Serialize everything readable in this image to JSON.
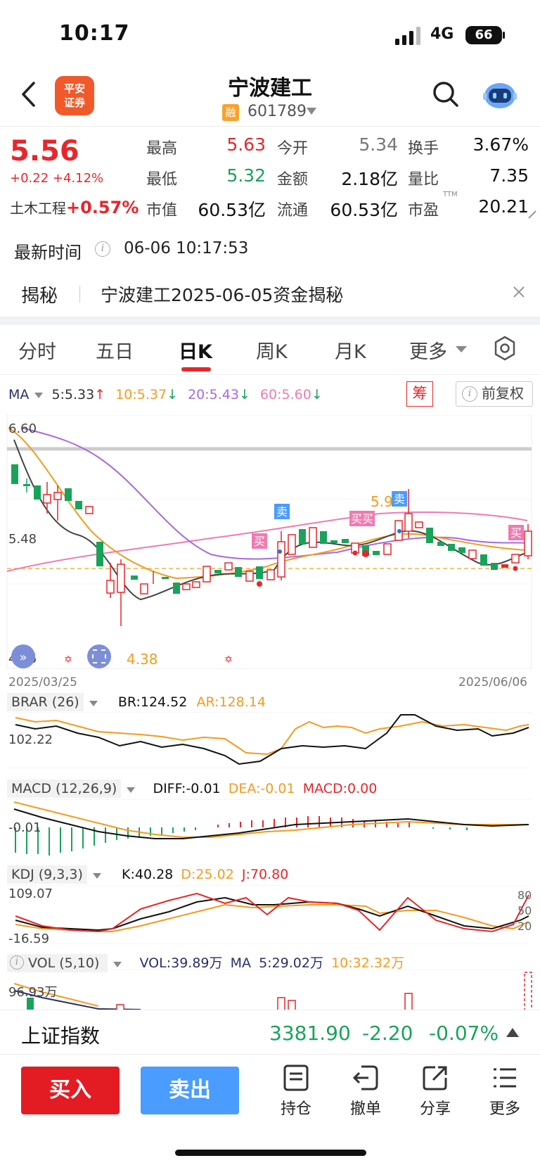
{
  "status_bar": {
    "time": "10:17",
    "network": "4G",
    "battery": "66"
  },
  "header": {
    "broker_logo": "平安\n证券",
    "stock_name": "宁波建工",
    "badge": "融",
    "stock_code": "601789"
  },
  "quote": {
    "price": "5.56",
    "change": "+0.22 +4.12%",
    "sector_name": "土木工程",
    "sector_change": "+0.57%",
    "fields": [
      {
        "label": "最高",
        "value": "5.63",
        "color": "#e8262b"
      },
      {
        "label": "今开",
        "value": "5.34",
        "color": "#777777"
      },
      {
        "label": "换手",
        "value": "3.67%",
        "color": "#111111"
      },
      {
        "label": "最低",
        "value": "5.32",
        "color": "#19a35a"
      },
      {
        "label": "金额",
        "value": "2.18亿",
        "color": "#111111"
      },
      {
        "label": "量比",
        "value": "7.35",
        "color": "#111111"
      },
      {
        "label": "市值",
        "value": "60.53亿",
        "color": "#111111"
      },
      {
        "label": "流通",
        "value": "60.53亿",
        "color": "#111111"
      },
      {
        "label": "市盈",
        "value": "20.21",
        "color": "#111111"
      }
    ],
    "pe_suffix": "TTM"
  },
  "latest": {
    "label": "最新时间",
    "value": "06-06 10:17:53"
  },
  "reveal": {
    "label": "揭秘",
    "text": "宁波建工2025-06-05资金揭秘"
  },
  "tabs": [
    "分时",
    "五日",
    "日K",
    "周K",
    "月K",
    "更多"
  ],
  "active_tab": "日K",
  "ma_legend": {
    "name": "MA",
    "ma5": "5:5.33",
    "ma10": "10:5.37",
    "ma20": "20:5.43",
    "ma60": "60:5.60",
    "chou": "筹",
    "fq": "前复权"
  },
  "kline": {
    "y_top": "6.60",
    "y_mid": "5.48",
    "y_bottom": "4.26",
    "low_label": "4.38",
    "high_label": "5.9",
    "date_start": "2025/03/25",
    "date_end": "2025/06/06",
    "markers": [
      "卖",
      "买",
      "买买",
      "卖",
      "买"
    ]
  },
  "brar": {
    "title": "BRAR (26)",
    "br": "BR:124.52",
    "ar": "AR:128.14",
    "axis": "102.22"
  },
  "macd": {
    "title": "MACD (12,26,9)",
    "diff": "DIFF:-0.01",
    "dea": "DEA:-0.01",
    "macd": "MACD:0.00",
    "axis": "-0.01"
  },
  "kdj": {
    "title": "KDJ (9,3,3)",
    "k": "K:40.28",
    "d": "D:25.02",
    "j": "J:70.80",
    "axis_top": "109.07",
    "axis_bottom": "-16.59",
    "r80": "80",
    "r50": "50",
    "r20": "20"
  },
  "vol": {
    "title": "VOL (5,10)",
    "vol": "VOL:39.89万",
    "ma": "MA",
    "ma5": "5:29.02万",
    "ma10": "10:32.32万",
    "axis": "96.93万"
  },
  "index": {
    "name": "上证指数",
    "value": "3381.90",
    "change": "-2.20",
    "pct": "-0.07%"
  },
  "actions": {
    "buy": "买入",
    "sell": "卖出",
    "hold": "持仓",
    "cancel": "撤单",
    "share": "分享",
    "more": "更多"
  },
  "colors": {
    "up": "#e8262b",
    "down": "#19a35a",
    "ma5": "#333333",
    "ma10": "#f39b1f",
    "ma20": "#a869e0",
    "ma60": "#f07ab0"
  }
}
